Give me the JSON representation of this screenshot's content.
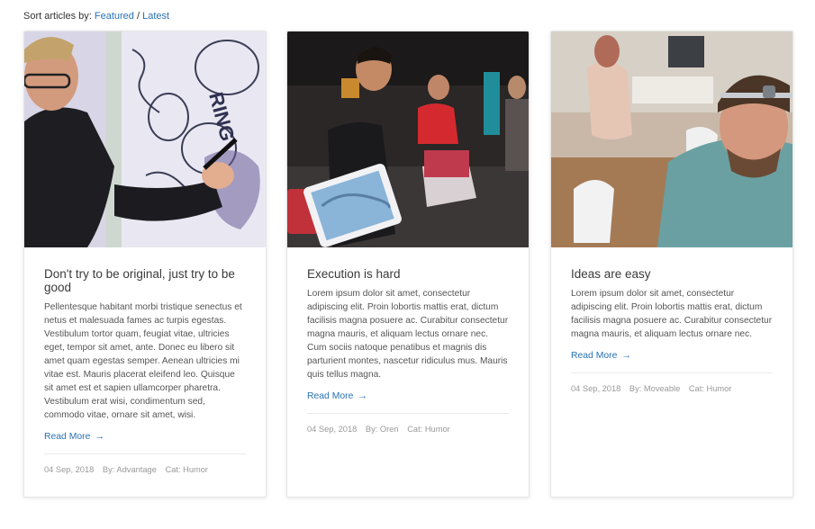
{
  "sort": {
    "label": "Sort articles by:",
    "options": [
      "Featured",
      "Latest"
    ],
    "separator": "/"
  },
  "articles": [
    {
      "title": "Don't try to be original, just try to be good",
      "excerpt": "Pellentesque habitant morbi tristique senectus et netus et malesuada fames ac turpis egestas. Vestibulum tortor quam, feugiat vitae, ultricies eget, tempor sit amet, ante. Donec eu libero sit amet quam egestas semper. Aenean ultricies mi vitae est. Mauris placerat eleifend leo. Quisque sit amet est et sapien ullamcorper pharetra. Vestibulum erat wisi, condimentum sed, commodo vitae, ornare sit amet, wisi.",
      "read_more": "Read More",
      "date": "04 Sep, 2018",
      "author": "By: Advantage",
      "category": "Cat: Humor"
    },
    {
      "title": "Execution is hard",
      "excerpt": "Lorem ipsum dolor sit amet, consectetur adipiscing elit. Proin lobortis mattis erat, dictum facilisis magna posuere ac. Curabitur consectetur magna mauris, et aliquam lectus ornare nec. Cum sociis natoque penatibus et magnis dis parturient montes, nascetur ridiculus mus. Mauris quis tellus magna.",
      "read_more": "Read More",
      "date": "04 Sep, 2018",
      "author": "By: Oren",
      "category": "Cat: Humor"
    },
    {
      "title": "Ideas are easy",
      "excerpt": "Lorem ipsum dolor sit amet, consectetur adipiscing elit. Proin lobortis mattis erat, dictum facilisis magna posuere ac. Curabitur consectetur magna mauris, et aliquam lectus ornare nec.",
      "read_more": "Read More",
      "date": "04 Sep, 2018",
      "author": "By: Moveable",
      "category": "Cat: Humor"
    }
  ],
  "icons": {
    "read_more": "arrow-right-icon"
  },
  "colors": {
    "link": "#2a72b5",
    "meta": "#999999",
    "title": "#3a3a3a"
  }
}
